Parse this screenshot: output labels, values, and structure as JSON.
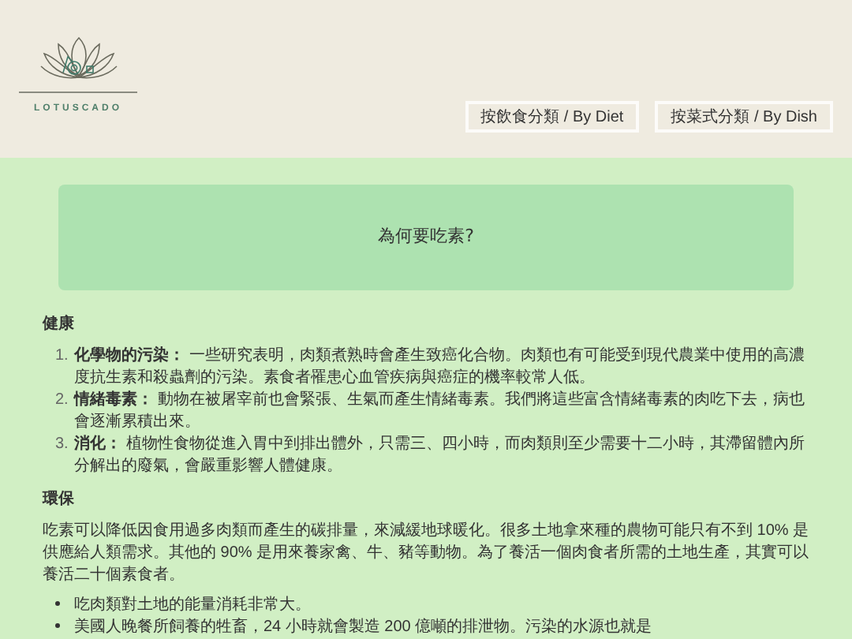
{
  "logo": {
    "text": "LOTUSCADO"
  },
  "nav": [
    {
      "label": "按飲食分類",
      "sub": " / By Diet"
    },
    {
      "label": "按菜式分類",
      "sub": " / By Dish"
    }
  ],
  "banner": {
    "title": "為何要吃素?"
  },
  "sections": [
    {
      "heading": "健康",
      "kind": "ordered",
      "items": [
        {
          "marker": "1.",
          "term": "化學物的污染：",
          "text": "一些研究表明，肉類煮熟時會產生致癌化合物。肉類也有可能受到現代農業中使用的高濃度抗生素和殺蟲劑的污染。素食者罹患心血管疾病與癌症的機率較常人低。"
        },
        {
          "marker": "2.",
          "term": "情緒毒素：",
          "text": "動物在被屠宰前也會緊張、生氣而產生情緒毒素。我們將這些富含情緒毒素的肉吃下去，病也會逐漸累積出來。"
        },
        {
          "marker": "3.",
          "term": "消化：",
          "text": "植物性食物從進入胃中到排出體外，只需三、四小時，而肉類則至少需要十二小時，其滯留體內所分解出的廢氣，會嚴重影響人體健康。"
        }
      ]
    },
    {
      "heading": "環保",
      "kind": "paragraph",
      "paragraph": "吃素可以降低因食用過多肉類而產生的碳排量，來減緩地球暖化。很多土地拿來種的農物可能只有不到 10% 是供應給人類需求。其他的 90% 是用來養家禽、牛、豬等動物。為了養活一個肉食者所需的土地生產，其實可以養活二十個素食者。",
      "items": [
        {
          "text": "吃肉類對土地的能量消耗非常大。"
        },
        {
          "text": "美國人晚餐所飼養的牲畜，24 小時就會製造 200 億噸的排泄物。污染的水源也就是"
        }
      ]
    }
  ]
}
